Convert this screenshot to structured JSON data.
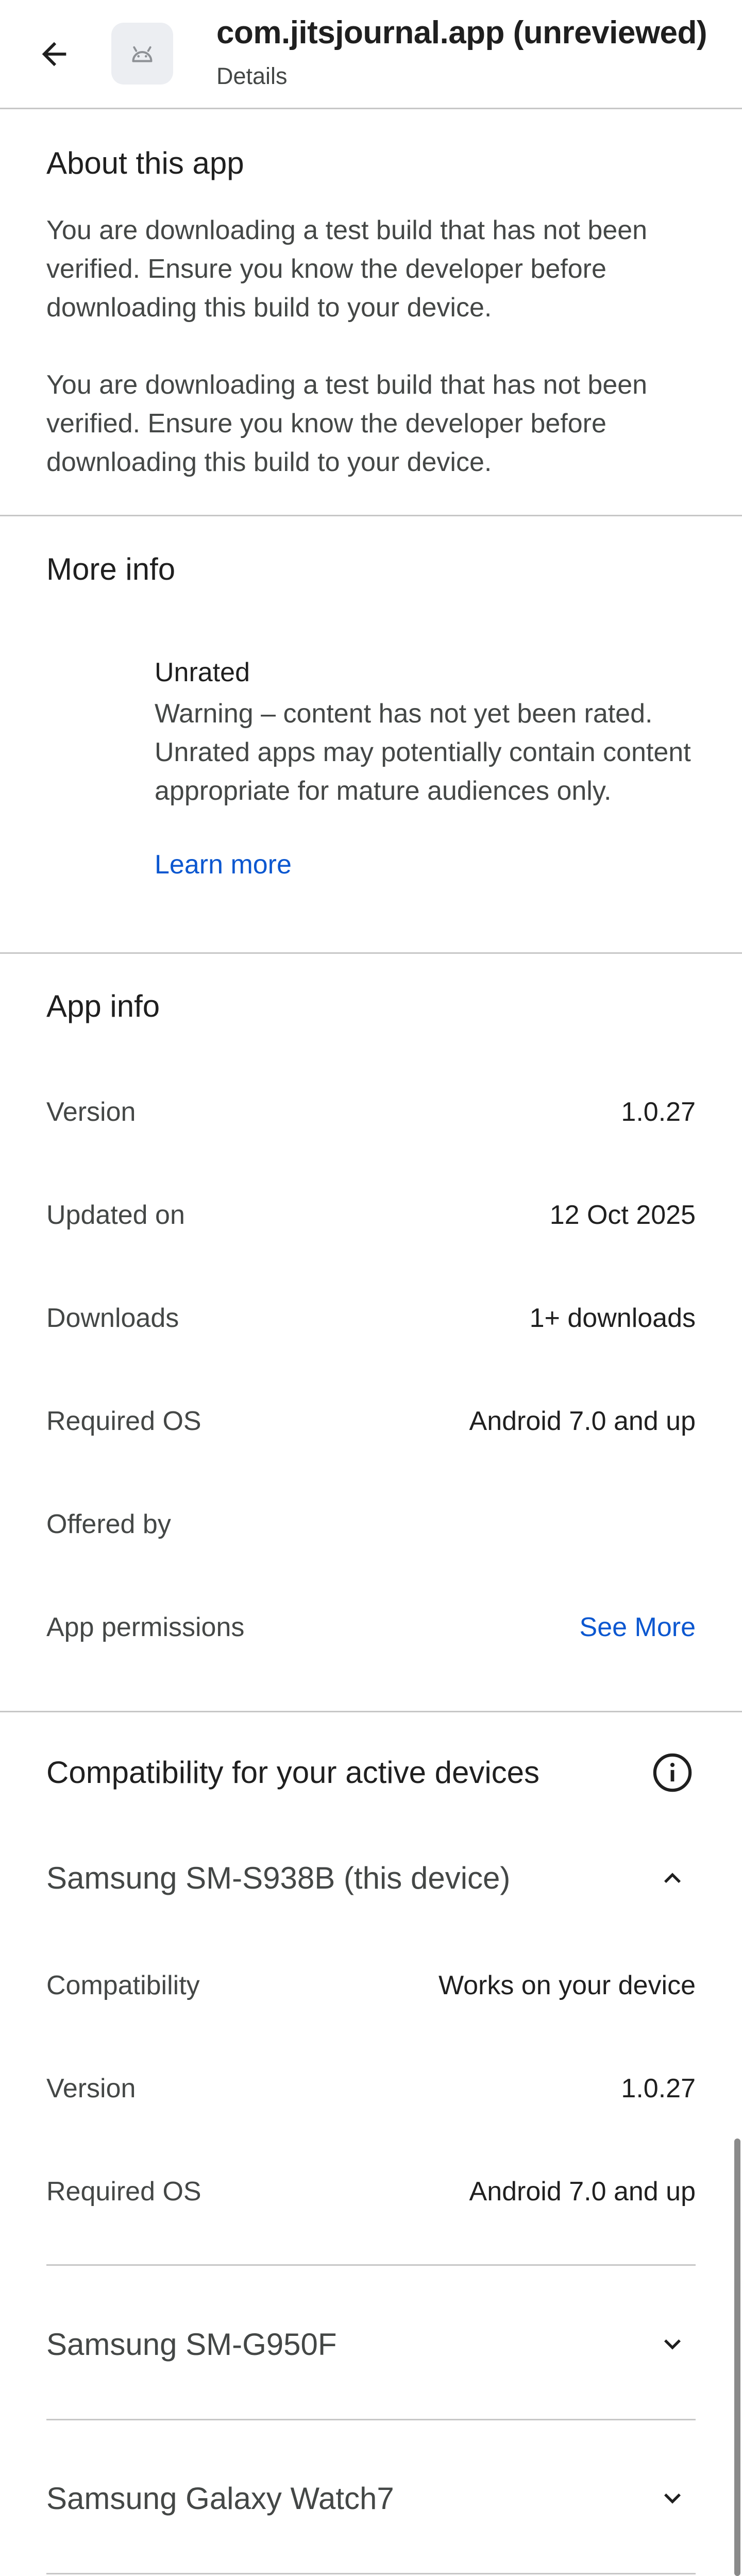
{
  "header": {
    "title": "com.jitsjournal.app (unreviewed)",
    "subtitle": "Details",
    "back_icon": "arrow-back-icon",
    "app_icon": "android-icon"
  },
  "about": {
    "title": "About this app",
    "paragraph1": "You are downloading a test build that has not been verified. Ensure you know the developer before downloading this build to your device.",
    "paragraph2": "You are downloading a test build that has not been verified. Ensure you know the developer before downloading this build to your device."
  },
  "more_info": {
    "title": "More info",
    "rating_title": "Unrated",
    "rating_text": "Warning – content has not yet been rated. Unrated apps may potentially contain content appropriate for mature audiences only.",
    "learn_more": "Learn more"
  },
  "app_info": {
    "title": "App info",
    "rows": [
      {
        "label": "Version",
        "value": "1.0.27"
      },
      {
        "label": "Updated on",
        "value": "12 Oct 2025"
      },
      {
        "label": "Downloads",
        "value": "1+ downloads"
      },
      {
        "label": "Required OS",
        "value": "Android 7.0 and up"
      },
      {
        "label": "Offered by",
        "value": ""
      },
      {
        "label": "App permissions",
        "value": "See More"
      }
    ]
  },
  "compatibility": {
    "title": "Compatibility for your active devices",
    "info_icon": "info-icon",
    "devices": [
      {
        "name": "Samsung SM-S938B (this device)",
        "expanded": true,
        "rows": [
          {
            "label": "Compatibility",
            "value": "Works on your device"
          },
          {
            "label": "Version",
            "value": "1.0.27"
          },
          {
            "label": "Required OS",
            "value": "Android 7.0 and up"
          }
        ]
      },
      {
        "name": "Samsung SM-G950F",
        "expanded": false
      },
      {
        "name": "Samsung Galaxy Watch7",
        "expanded": false
      }
    ]
  },
  "colors": {
    "link": "#0b57d0",
    "divider": "#c7c7c7",
    "secondary_text": "#444746",
    "primary_text": "#1f1f1f"
  }
}
